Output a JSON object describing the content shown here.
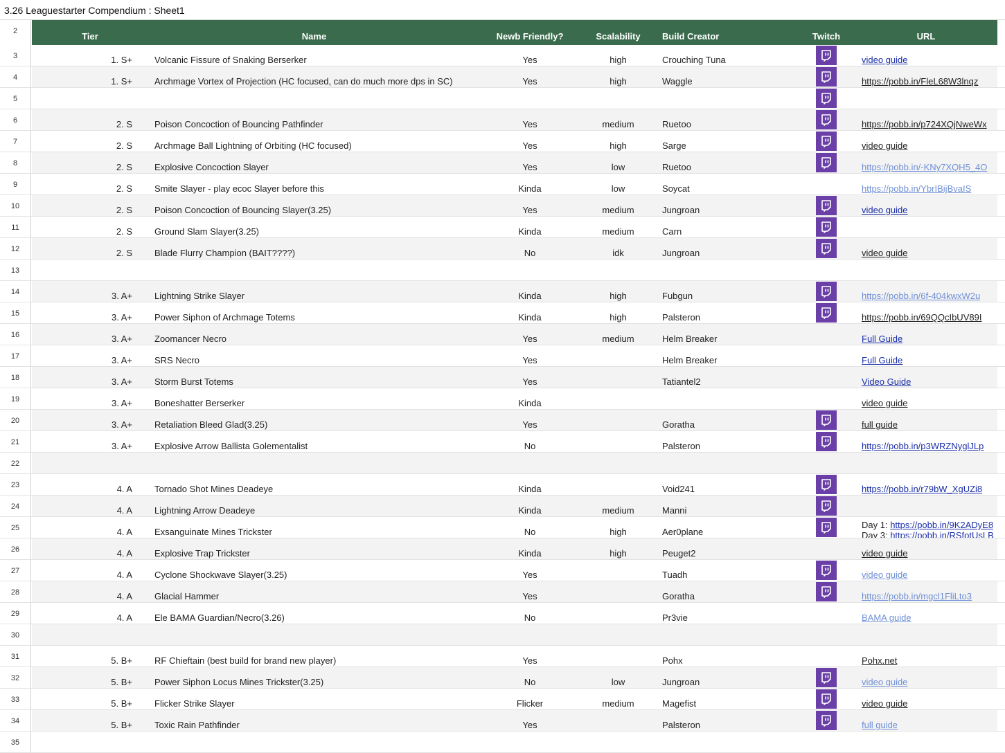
{
  "title": "3.26 Leaguestarter Compendium : Sheet1",
  "colors": {
    "header_bg": "#3a6b4c",
    "twitch": "#6b3fa8",
    "link_blue": "#1a2ea8",
    "link_light": "#6f8fd6"
  },
  "header": {
    "row": "2",
    "tier": "Tier",
    "name": "Name",
    "newb": "Newb Friendly?",
    "scal": "Scalability",
    "creator": "Build Creator",
    "twitch": "Twitch",
    "url": "URL"
  },
  "rows": [
    {
      "n": "3",
      "tier": "1. S+",
      "name": "Volcanic Fissure of Snaking Berserker",
      "newb": "Yes",
      "scal": "high",
      "creator": "Crouching Tuna",
      "twitch": true,
      "url": "video guide",
      "style": "blue"
    },
    {
      "n": "4",
      "tier": "1. S+",
      "name": "Archmage Vortex of Projection (HC focused, can do much more dps in SC)",
      "newb": "Yes",
      "scal": "high",
      "creator": "Waggle",
      "twitch": true,
      "url": "https://pobb.in/FleL68W3lnqz",
      "style": "dark"
    },
    {
      "n": "5",
      "tier": "",
      "name": "",
      "newb": "",
      "scal": "",
      "creator": "",
      "twitch": true,
      "url": "",
      "style": "dark"
    },
    {
      "n": "6",
      "tier": "2. S",
      "name": "Poison Concoction of Bouncing Pathfinder",
      "newb": "Yes",
      "scal": "medium",
      "creator": "Ruetoo",
      "twitch": true,
      "url": "https://pobb.in/p724XQjNweWx",
      "style": "dark"
    },
    {
      "n": "7",
      "tier": "2. S",
      "name": "Archmage Ball Lightning of Orbiting (HC focused)",
      "newb": "Yes",
      "scal": "high",
      "creator": "Sarge",
      "twitch": true,
      "url": "video guide",
      "style": "dark"
    },
    {
      "n": "8",
      "tier": "2. S",
      "name": "Explosive Concoction Slayer",
      "newb": "Yes",
      "scal": "low",
      "creator": "Ruetoo",
      "twitch": true,
      "url": "https://pobb.in/-KNy7XQH5_4O",
      "style": "light"
    },
    {
      "n": "9",
      "tier": "2. S",
      "name": "Smite Slayer - play ecoc Slayer before this",
      "newb": "Kinda",
      "scal": "low",
      "creator": "Soycat",
      "twitch": false,
      "url": "https://pobb.in/YbrIBijBvaIS",
      "style": "light"
    },
    {
      "n": "10",
      "tier": "2. S",
      "name": "Poison Concoction of Bouncing Slayer(3.25)",
      "newb": "Yes",
      "scal": "medium",
      "creator": "Jungroan",
      "twitch": true,
      "url": "video guide",
      "style": "blue"
    },
    {
      "n": "11",
      "tier": "2. S",
      "name": "Ground Slam Slayer(3.25)",
      "newb": "Kinda",
      "scal": "medium",
      "creator": "Carn",
      "twitch": true,
      "url": "",
      "style": "dark"
    },
    {
      "n": "12",
      "tier": "2. S",
      "name": "Blade Flurry Champion (BAIT????)",
      "newb": "No",
      "scal": "idk",
      "creator": "Jungroan",
      "twitch": true,
      "url": "video guide",
      "style": "dark"
    },
    {
      "n": "13",
      "tier": "",
      "name": "",
      "newb": "",
      "scal": "",
      "creator": "",
      "twitch": false,
      "url": "",
      "style": "dark"
    },
    {
      "n": "14",
      "tier": "3. A+",
      "name": "Lightning Strike Slayer",
      "newb": "Kinda",
      "scal": "high",
      "creator": "Fubgun",
      "twitch": true,
      "url": "https://pobb.in/6f-404kwxW2u",
      "style": "light"
    },
    {
      "n": "15",
      "tier": "3. A+",
      "name": "Power Siphon of Archmage Totems",
      "newb": "Kinda",
      "scal": "high",
      "creator": "Palsteron",
      "twitch": true,
      "url": "https://pobb.in/69QQcIbUV89I",
      "style": "dark"
    },
    {
      "n": "16",
      "tier": "3. A+",
      "name": "Zoomancer Necro",
      "newb": "Yes",
      "scal": "medium",
      "creator": "Helm Breaker",
      "twitch": false,
      "url": "Full Guide",
      "style": "blue"
    },
    {
      "n": "17",
      "tier": "3. A+",
      "name": "SRS Necro",
      "newb": "Yes",
      "scal": "",
      "creator": "Helm Breaker",
      "twitch": false,
      "url": "Full Guide",
      "style": "blue"
    },
    {
      "n": "18",
      "tier": "3. A+",
      "name": "Storm Burst Totems",
      "newb": "Yes",
      "scal": "",
      "creator": "Tatiantel2",
      "twitch": false,
      "url": "Video Guide",
      "style": "blue"
    },
    {
      "n": "19",
      "tier": "3. A+",
      "name": "Boneshatter Berserker",
      "newb": "Kinda",
      "scal": "",
      "creator": "",
      "twitch": false,
      "url": "video guide",
      "style": "dark"
    },
    {
      "n": "20",
      "tier": "3. A+",
      "name": "Retaliation Bleed Glad(3.25)",
      "newb": "Yes",
      "scal": "",
      "creator": "Goratha",
      "twitch": true,
      "url": "full guide",
      "style": "dark"
    },
    {
      "n": "21",
      "tier": "3. A+",
      "name": "Explosive Arrow Ballista Golementalist",
      "newb": "No",
      "scal": "",
      "creator": "Palsteron",
      "twitch": true,
      "url": "https://pobb.in/p3WRZNyglJLp",
      "style": "blue"
    },
    {
      "n": "22",
      "tier": "",
      "name": "",
      "newb": "",
      "scal": "",
      "creator": "",
      "twitch": false,
      "url": "",
      "style": "dark"
    },
    {
      "n": "23",
      "tier": "4. A",
      "name": "Tornado Shot Mines Deadeye",
      "newb": "Kinda",
      "scal": "",
      "creator": "Void241",
      "twitch": true,
      "url": "https://pobb.in/r79bW_XgUZi8",
      "style": "blue"
    },
    {
      "n": "24",
      "tier": "4. A",
      "name": "Lightning Arrow Deadeye",
      "newb": "Kinda",
      "scal": "medium",
      "creator": "Manni",
      "twitch": true,
      "url": "",
      "style": "dark"
    },
    {
      "n": "25",
      "tier": "4. A",
      "name": "Exsanguinate Mines Trickster",
      "newb": "No",
      "scal": "high",
      "creator": "Aer0plane",
      "twitch": true,
      "url": "",
      "style": "blue",
      "day1_label": "Day 1: ",
      "day1_url": "https://pobb.in/9K2ADyE8",
      "day3_label": "Day 3: ",
      "day3_url": "https://pobb.in/RSfotUsLB"
    },
    {
      "n": "26",
      "tier": "4. A",
      "name": "Explosive Trap Trickster",
      "newb": "Kinda",
      "scal": "high",
      "creator": "Peuget2",
      "twitch": false,
      "url": "video guide",
      "style": "dark"
    },
    {
      "n": "27",
      "tier": "4. A",
      "name": "Cyclone Shockwave Slayer(3.25)",
      "newb": "Yes",
      "scal": "",
      "creator": "Tuadh",
      "twitch": true,
      "url": "video guide",
      "style": "light"
    },
    {
      "n": "28",
      "tier": "4. A",
      "name": "Glacial Hammer",
      "newb": "Yes",
      "scal": "",
      "creator": "Goratha",
      "twitch": true,
      "url": "https://pobb.in/mgcl1FliLto3",
      "style": "light"
    },
    {
      "n": "29",
      "tier": "4. A",
      "name": "Ele BAMA Guardian/Necro(3.26)",
      "newb": "No",
      "scal": "",
      "creator": "Pr3vie",
      "twitch": false,
      "url": "BAMA guide",
      "style": "light"
    },
    {
      "n": "30",
      "tier": "",
      "name": "",
      "newb": "",
      "scal": "",
      "creator": "",
      "twitch": false,
      "url": "",
      "style": "dark"
    },
    {
      "n": "31",
      "tier": "5. B+",
      "name": "RF Chieftain (best build for brand new player)",
      "newb": "Yes",
      "scal": "",
      "creator": "Pohx",
      "twitch": false,
      "url": "Pohx.net",
      "style": "dark"
    },
    {
      "n": "32",
      "tier": "5. B+",
      "name": "Power Siphon Locus Mines Trickster(3.25)",
      "newb": "No",
      "scal": "low",
      "creator": "Jungroan",
      "twitch": true,
      "url": "video guide",
      "style": "light"
    },
    {
      "n": "33",
      "tier": "5. B+",
      "name": "Flicker Strike Slayer",
      "newb": "Flicker",
      "scal": "medium",
      "creator": "Magefist",
      "twitch": true,
      "url": "video guide",
      "style": "dark"
    },
    {
      "n": "34",
      "tier": "5. B+",
      "name": "Toxic Rain Pathfinder",
      "newb": "Yes",
      "scal": "",
      "creator": "Palsteron",
      "twitch": true,
      "url": "full guide",
      "style": "light"
    },
    {
      "n": "35",
      "tier": "",
      "name": "",
      "newb": "",
      "scal": "",
      "creator": "",
      "twitch": false,
      "url": "",
      "style": "dark"
    }
  ]
}
